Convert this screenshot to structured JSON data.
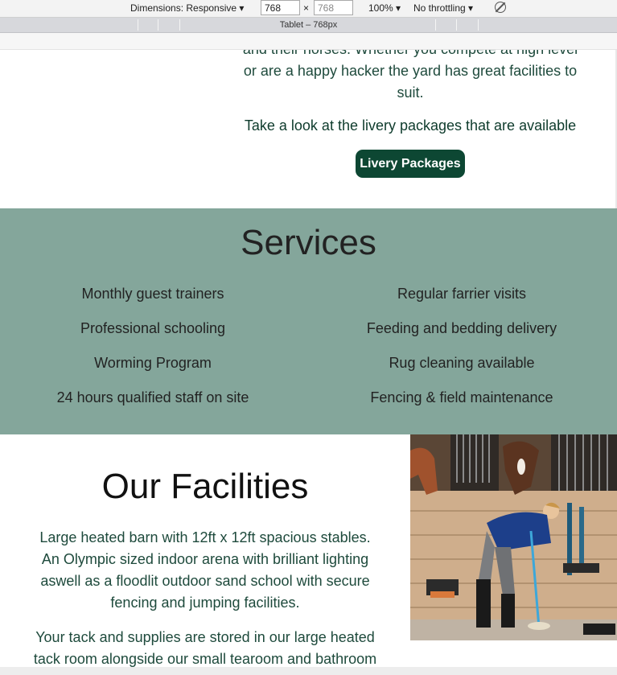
{
  "devtools": {
    "dimensions_label": "Dimensions: Responsive ▾",
    "width_value": "768",
    "times": "×",
    "height_placeholder": "768",
    "zoom": "100% ▾",
    "throttling": "No throttling ▾",
    "media_label": "Tablet – 768px"
  },
  "intro": {
    "line1": "and their horses. Whether you compete at high level",
    "line2": "or are a happy hacker the yard has great facilities to",
    "line3": "suit.",
    "cta_text": "Take a look at the livery packages that are available",
    "button_label": "Livery Packages"
  },
  "services": {
    "title": "Services",
    "left": [
      "Monthly guest trainers",
      "Professional schooling",
      "Worming Program",
      "24 hours qualified staff on site"
    ],
    "right": [
      "Regular farrier visits",
      "Feeding and bedding delivery",
      "Rug cleaning available",
      "Fencing & field maintenance"
    ]
  },
  "facilities": {
    "title": "Our Facilities",
    "p1_l1": "Large heated barn with 12ft x 12ft spacious stables.",
    "p1_l2": "An Olympic sized indoor arena with brilliant lighting",
    "p1_l3": "aswell as a floodlit outdoor sand school with secure",
    "p1_l4": "fencing and jumping facilities.",
    "p2_l1": "Your tack and supplies are stored in our large heated",
    "p2_l2": "tack room alongside our small tearoom and bathroom"
  },
  "colors": {
    "services_bg": "#84a69b",
    "button_bg": "#0d4733",
    "text_green": "#1e4a3c"
  }
}
